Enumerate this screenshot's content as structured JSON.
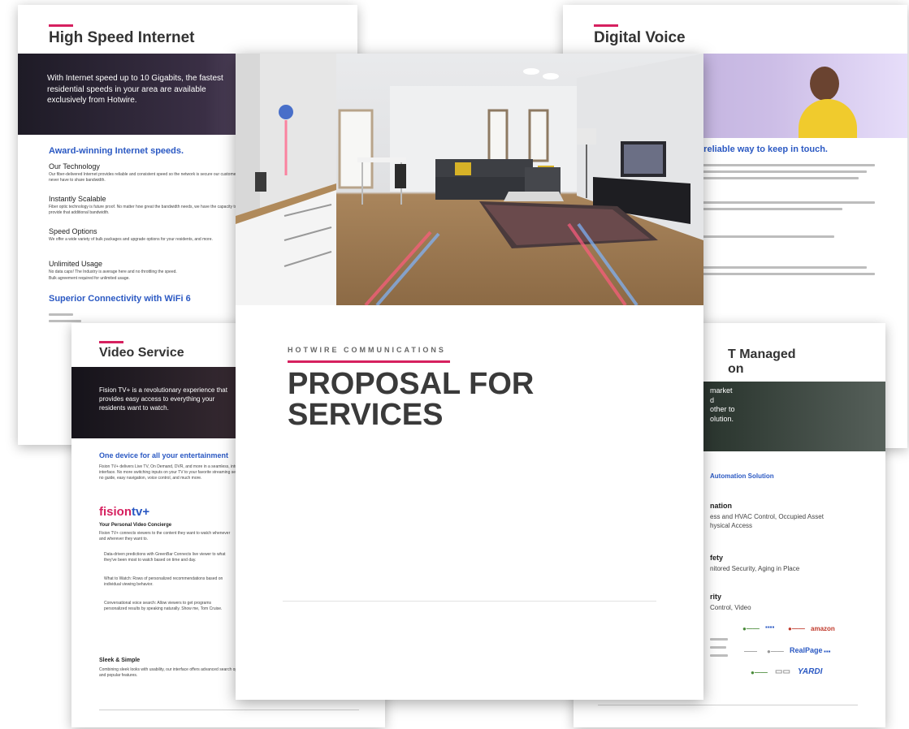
{
  "internet_page": {
    "title": "High Speed Internet",
    "banner_text": "With Internet speed up to 10 Gigabits, the fastest residential speeds in your area are available exclusively from Hotwire.",
    "heading1": "Award-winning Internet speeds.",
    "sections": [
      {
        "title": "Our Technology",
        "text": "Our fiber-delivered Internet provides reliable and consistent speed so the network is secure our customers never have to share bandwidth."
      },
      {
        "title": "Instantly Scalable",
        "text": "Fiber optic technology is future proof. No matter how great the bandwidth needs, we have the capacity to provide that additional bandwidth."
      },
      {
        "title": "Speed Options",
        "text": "We offer a wide variety of bulk packages and upgrade options for your residents, and more."
      },
      {
        "title": "Unlimited Usage",
        "text": "No data caps! The Industry is average here and no throttling the speed."
      }
    ],
    "footnote": "Bulk agreement required for unlimited usage.",
    "heading2": "Superior Connectivity with WiFi 6"
  },
  "voice_page": {
    "title": "Digital Voice",
    "heading": "a reliable way to keep in touch."
  },
  "video_page": {
    "title": "Video Service",
    "banner_text": "Fision TV+ is a revolutionary experience that provides easy access to everything your residents want to watch.",
    "heading": "One device for all your entertainment",
    "body": "Fision TV+ delivers Live TV, On Demand, DVR, and more in a seamless, intuitive interface. No more switching inputs on your TV to your favorite streaming service. Fill no guide, easy navigation, voice control, and much more.",
    "logo_main": "fision",
    "logo_tv": "tv+",
    "concierge_title": "Your Personal Video Concierge",
    "concierge_text": "Fision TV+ connects viewers to the content they want to watch whenever and wherever they want to.",
    "bullets": [
      "Data-driven predictions with GreenBar Connects live viewer to what they've been most to watch based on time and day.",
      "What to Watch: Rows of personalized recommendations based on individual viewing behavior.",
      "Conversational voice search: Allow viewers to get programs personalized results by speaking naturally. Show me, Tom Cruise."
    ],
    "sleek_title": "Sleek & Simple",
    "sleek_text": "Combining sleek looks with usability, our interface offers advanced search options and popular features."
  },
  "iot_page": {
    "title_line1": "T Managed",
    "title_line2": "on",
    "banner_text": "market\nd\nother to\nolution.",
    "solution_heading": "Automation Solution",
    "items": [
      {
        "title": "nation",
        "text": "ess and HVAC Control, Occupied Asset\nhysical Access"
      },
      {
        "title": "fety",
        "text": "nitored Security, Aging in Place"
      },
      {
        "title": "rity",
        "text": "Control, Video"
      }
    ],
    "partner_logos": [
      "",
      "",
      "",
      "amazon",
      "",
      "",
      "RealPage",
      "",
      "",
      "",
      "YARDI"
    ]
  },
  "cover": {
    "company": "HOTWIRE COMMUNICATIONS",
    "title_line1": "PROPOSAL FOR",
    "title_line2": "SERVICES"
  },
  "colors": {
    "accent": "#d6205f",
    "heading_blue": "#2b59c3",
    "title_gray": "#333333"
  }
}
